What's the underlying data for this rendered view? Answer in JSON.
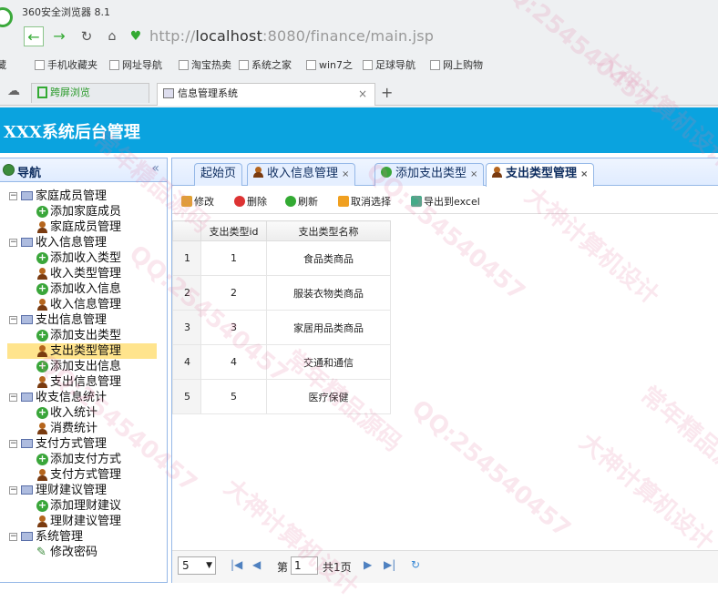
{
  "browser": {
    "name": "360安全浏览器 8.1",
    "url_scheme": "http://",
    "url_host": "localhost",
    "url_rest": ":8080/finance/main.jsp",
    "bookmarks": [
      "藏",
      "手机收藏夹",
      "网址导航",
      "淘宝热卖",
      "系统之家",
      "win7之",
      "足球导航",
      "网上购物"
    ],
    "split_tab": "跨屏浏览",
    "active_tab": "信息管理系统"
  },
  "app": {
    "title": "XXX系统后台管理",
    "accent": "#0aa3df"
  },
  "sidebar": {
    "title": "导航",
    "collapse_glyph": "«",
    "groups": [
      {
        "label": "家庭成员管理",
        "items": [
          {
            "label": "添加家庭成员",
            "icon": "plus"
          },
          {
            "label": "家庭成员管理",
            "icon": "user"
          }
        ]
      },
      {
        "label": "收入信息管理",
        "items": [
          {
            "label": "添加收入类型",
            "icon": "plus"
          },
          {
            "label": "收入类型管理",
            "icon": "user"
          },
          {
            "label": "添加收入信息",
            "icon": "plus"
          },
          {
            "label": "收入信息管理",
            "icon": "user"
          }
        ]
      },
      {
        "label": "支出信息管理",
        "items": [
          {
            "label": "添加支出类型",
            "icon": "plus"
          },
          {
            "label": "支出类型管理",
            "icon": "user",
            "selected": true
          },
          {
            "label": "添加支出信息",
            "icon": "plus"
          },
          {
            "label": "支出信息管理",
            "icon": "user"
          }
        ]
      },
      {
        "label": "收支信息统计",
        "items": [
          {
            "label": "收入统计",
            "icon": "plus"
          },
          {
            "label": "消费统计",
            "icon": "user"
          }
        ]
      },
      {
        "label": "支付方式管理",
        "items": [
          {
            "label": "添加支付方式",
            "icon": "plus"
          },
          {
            "label": "支付方式管理",
            "icon": "user"
          }
        ]
      },
      {
        "label": "理财建议管理",
        "items": [
          {
            "label": "添加理财建议",
            "icon": "plus"
          },
          {
            "label": "理财建议管理",
            "icon": "user"
          }
        ]
      },
      {
        "label": "系统管理",
        "items": [
          {
            "label": "修改密码",
            "icon": "pen"
          }
        ]
      }
    ]
  },
  "tabs": [
    {
      "label": "起始页",
      "icon": "none",
      "closable": false
    },
    {
      "label": "收入信息管理",
      "icon": "user",
      "closable": true
    },
    {
      "label": "添加支出类型",
      "icon": "plus",
      "closable": true
    },
    {
      "label": "支出类型管理",
      "icon": "user",
      "closable": true,
      "active": true
    }
  ],
  "toolbar": {
    "edit": "修改",
    "delete": "删除",
    "refresh": "刷新",
    "cancel": "取消选择",
    "export": "导出到excel"
  },
  "grid": {
    "columns": [
      "支出类型id",
      "支出类型名称"
    ],
    "rows": [
      {
        "n": "1",
        "id": "1",
        "name": "食品类商品"
      },
      {
        "n": "2",
        "id": "2",
        "name": "服装衣物类商品"
      },
      {
        "n": "3",
        "id": "3",
        "name": "家居用品类商品"
      },
      {
        "n": "4",
        "id": "4",
        "name": "交通和通信"
      },
      {
        "n": "5",
        "id": "5",
        "name": "医疗保健"
      }
    ]
  },
  "pager": {
    "page_size": "5",
    "page_prefix": "第",
    "page_value": "1",
    "page_total": "共1页"
  },
  "watermark": {
    "texts": [
      "QQ:254540457",
      "大神计算机设计",
      "常年精品源码"
    ]
  }
}
